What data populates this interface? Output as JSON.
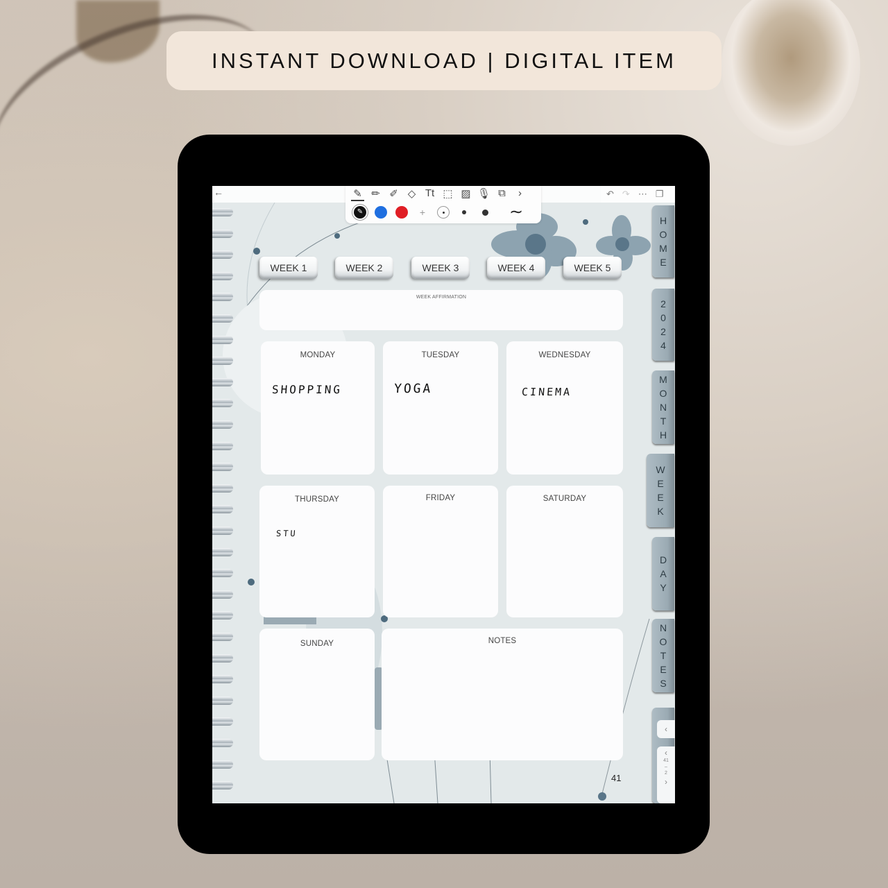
{
  "banner": {
    "text": "INSTANT DOWNLOAD | DIGITAL ITEM"
  },
  "app": {
    "toolbar": {
      "tools": [
        {
          "icon": "pen-icon",
          "glyph": "✎"
        },
        {
          "icon": "pencil-icon",
          "glyph": "✏"
        },
        {
          "icon": "highlighter-icon",
          "glyph": "✐"
        },
        {
          "icon": "eraser-icon",
          "glyph": "◇"
        },
        {
          "icon": "text-icon",
          "glyph": "Tt"
        },
        {
          "icon": "lasso-select-icon",
          "glyph": "⬚"
        },
        {
          "icon": "image-icon",
          "glyph": "▨"
        },
        {
          "icon": "microphone-icon",
          "glyph": "🎙"
        },
        {
          "icon": "shapes-icon",
          "glyph": "⧉"
        },
        {
          "icon": "more-tools-chevron-icon",
          "glyph": "›"
        }
      ],
      "colors": [
        "#111111",
        "#1f6fe0",
        "#e01e25"
      ],
      "add_color": "+",
      "stroke_style": "∼"
    },
    "right_controls": {
      "undo": "↶",
      "redo": "↷",
      "more": "⋯",
      "pages": "❐"
    },
    "back": "←"
  },
  "planner": {
    "week_tabs": [
      "WEEK 1",
      "WEEK 2",
      "WEEK 3",
      "WEEK 4",
      "WEEK 5"
    ],
    "affirmation_label": "WEEK AFFIRMATION",
    "days": [
      {
        "label": "MONDAY",
        "entry": "SHOPPING"
      },
      {
        "label": "TUESDAY",
        "entry": "YOGA"
      },
      {
        "label": "WEDNESDAY",
        "entry": "CINEMA"
      },
      {
        "label": "THURSDAY",
        "entry": "STU"
      },
      {
        "label": "FRIDAY",
        "entry": ""
      },
      {
        "label": "SATURDAY",
        "entry": ""
      },
      {
        "label": "SUNDAY",
        "entry": ""
      }
    ],
    "notes_label": "NOTES",
    "page_number": "41"
  },
  "side_tabs": [
    {
      "label": "HOME",
      "letters": [
        "H",
        "O",
        "M",
        "E"
      ]
    },
    {
      "label": "2024",
      "letters": [
        "2",
        "0",
        "2",
        "4"
      ]
    },
    {
      "label": "MONTH",
      "letters": [
        "M",
        "O",
        "N",
        "T",
        "H"
      ]
    },
    {
      "label": "WEEK",
      "letters": [
        "W",
        "E",
        "E",
        "K"
      ]
    },
    {
      "label": "DAY",
      "letters": [
        "D",
        "A",
        "Y"
      ]
    },
    {
      "label": "NOTES",
      "letters": [
        "N",
        "O",
        "T",
        "E",
        "S"
      ]
    }
  ],
  "page_nav": {
    "collapse": "‹",
    "prev": "‹",
    "current": "41",
    "total": "2",
    "next": "›"
  }
}
